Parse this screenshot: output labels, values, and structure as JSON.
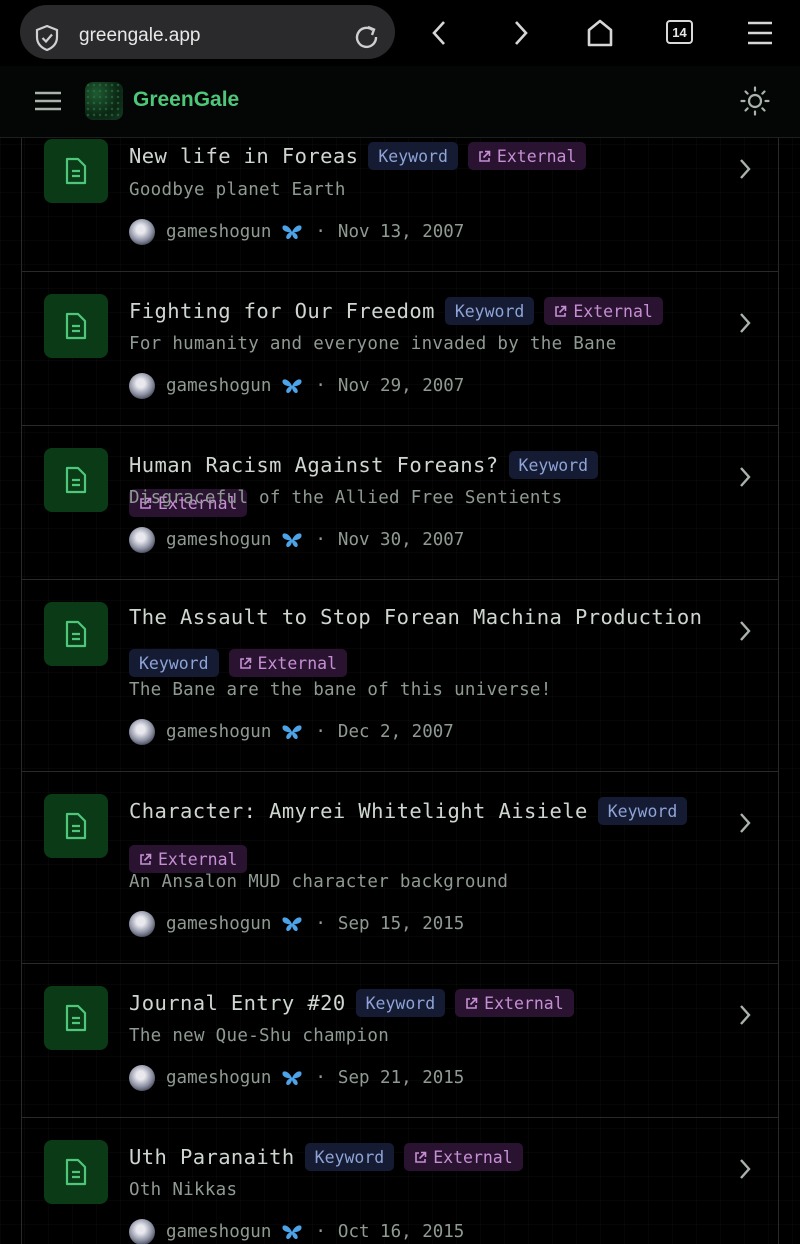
{
  "browser": {
    "url": "greengale.app",
    "tab_count": "14"
  },
  "site": {
    "brand": "GreenGale"
  },
  "colors": {
    "accent": "#4ec77a",
    "tile": "#0b3a17",
    "keyword_bg": "#141b33",
    "external_bg": "#2a1330"
  },
  "posts": [
    {
      "title": "New life in Foreas",
      "subtitle": "Goodbye planet Earth",
      "author": "gameshogun",
      "date": "Nov 13, 2007",
      "keyword": "Keyword",
      "external": "External"
    },
    {
      "title": "Fighting for Our Freedom",
      "subtitle": "For humanity and everyone invaded by the Bane",
      "author": "gameshogun",
      "date": "Nov 29, 2007",
      "keyword": "Keyword",
      "external": "External"
    },
    {
      "title": "Human Racism Against Foreans?",
      "subtitle": "Disgraceful of the Allied Free Sentients",
      "author": "gameshogun",
      "date": "Nov 30, 2007",
      "keyword": "Keyword",
      "external": "External"
    },
    {
      "title": "The Assault to Stop Forean Machina Production",
      "subtitle": "The Bane are the bane of this universe!",
      "author": "gameshogun",
      "date": "Dec 2, 2007",
      "keyword": "Keyword",
      "external": "External"
    },
    {
      "title": "Character: Amyrei Whitelight Aisiele",
      "subtitle": "An Ansalon MUD character background",
      "author": "gameshogun",
      "date": "Sep 15, 2015",
      "keyword": "Keyword",
      "external": "External"
    },
    {
      "title": "Journal Entry #20",
      "subtitle": "The new Que-Shu champion",
      "author": "gameshogun",
      "date": "Sep 21, 2015",
      "keyword": "Keyword",
      "external": "External"
    },
    {
      "title": "Uth Paranaith",
      "subtitle": "Oth Nikkas",
      "author": "gameshogun",
      "date": "Oct 16, 2015",
      "keyword": "Keyword",
      "external": "External"
    }
  ]
}
